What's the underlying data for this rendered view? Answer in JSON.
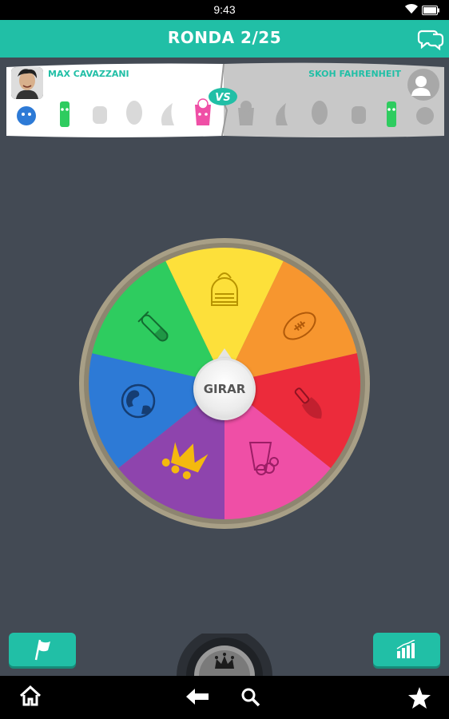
{
  "status_bar": {
    "time": "9:43"
  },
  "header": {
    "title": "RONDA 2/25"
  },
  "players": {
    "player1": {
      "name": "MAX CAVAZZANI"
    },
    "player2": {
      "name": "SKOH FAHRENHEIT"
    },
    "vs_label": "VS"
  },
  "wheel": {
    "spin_label": "GIRAR",
    "categories": [
      {
        "icon": "knight-helmet-icon",
        "color": "#fde03a"
      },
      {
        "icon": "football-icon",
        "color": "#f7962f"
      },
      {
        "icon": "paintbrush-icon",
        "color": "#ec2b3b"
      },
      {
        "icon": "popcorn-icon",
        "color": "#ef4fa6"
      },
      {
        "icon": "crown-icon",
        "color": "#8e44ad"
      },
      {
        "icon": "globe-icon",
        "color": "#2d7ad6"
      },
      {
        "icon": "test-tube-icon",
        "color": "#2ecc5f"
      }
    ]
  },
  "colors": {
    "accent": "#21bfa6",
    "background": "#434a54",
    "wheel_rim": "#a89f86"
  }
}
